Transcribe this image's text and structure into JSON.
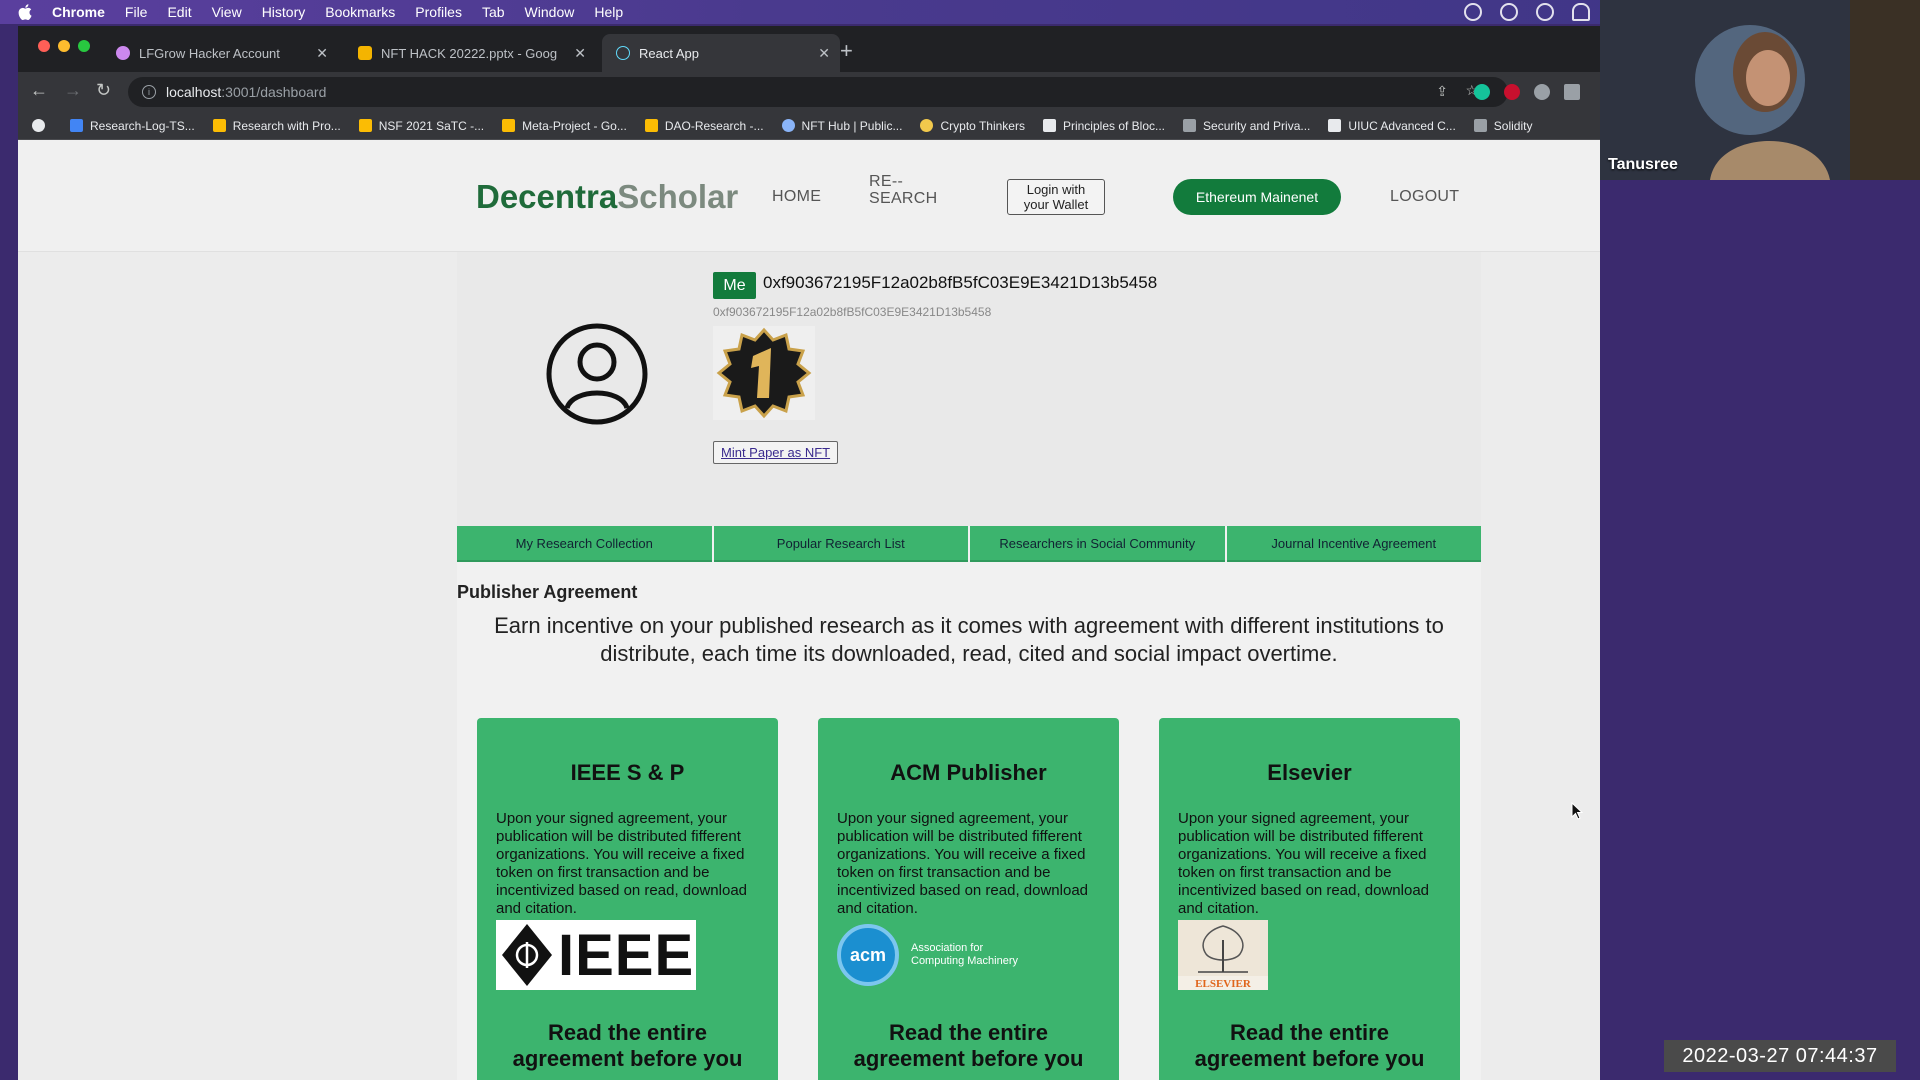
{
  "menubar": {
    "app": "Chrome",
    "items": [
      "File",
      "Edit",
      "View",
      "History",
      "Bookmarks",
      "Profiles",
      "Tab",
      "Window",
      "Help"
    ]
  },
  "tabs": [
    {
      "title": "LFGrow Hacker Account",
      "active": false
    },
    {
      "title": "NFT HACK 20222.pptx - Googl",
      "active": false
    },
    {
      "title": "React App",
      "active": true
    }
  ],
  "address": {
    "host": "localhost",
    "path": ":3001/dashboard"
  },
  "bookmarks": [
    "Research-Log-TS...",
    "Research with Pro...",
    "NSF 2021 SaTC -...",
    "Meta-Project - Go...",
    "DAO-Research -...",
    "NFT Hub | Public...",
    "Crypto Thinkers",
    "Principles of Bloc...",
    "Security and Priva...",
    "UIUC Advanced C...",
    "Solidity"
  ],
  "header": {
    "logo_a": "Decentra",
    "logo_b": "Scholar",
    "nav_home": "HOME",
    "nav_research_1": "RE--",
    "nav_research_2": "SEARCH",
    "wallet_1": "Login with",
    "wallet_2": "your Wallet",
    "network": "Ethereum Mainenet",
    "logout": "LOGOUT"
  },
  "profile": {
    "me_label": "Me",
    "address_checksum": "0xf903672195F12a02b8fB5fC03E9E3421D13b5458",
    "address_lower": "0xf903672195F12a02b8fB5fC03E9E3421D13b5458",
    "mint_label": "Mint Paper as NFT"
  },
  "profile_tabs": [
    "My Research Collection",
    "Popular Research List",
    "Researchers in Social Community",
    "Journal Incentive Agreement"
  ],
  "section": {
    "title": "Publisher Agreement",
    "lead": "Earn incentive on your published research as it comes with agreement with different institutions to distribute, each time its downloaded, read, cited and social impact overtime."
  },
  "publishers": [
    {
      "name": "IEEE S & P",
      "body": "Upon your signed agreement, your publication will be distributed fifferent organizations. You will receive a fixed token on first transaction and be incentivized based on read, download and citation.",
      "logo_text": "IEEE",
      "read": "Read the entire agreement before you"
    },
    {
      "name": "ACM Publisher",
      "body": "Upon your signed agreement, your publication will be distributed fifferent organizations. You will receive a fixed token on first transaction and be incentivized based on read, download and citation.",
      "logo_text": "acm",
      "logo_sub_1": "Association for",
      "logo_sub_2": "Computing Machinery",
      "read": "Read the entire agreement before you"
    },
    {
      "name": "Elsevier",
      "body": "Upon your signed agreement, your publication will be distributed fifferent organizations. You will receive a fixed token on first transaction and be incentivized based on read, download and citation.",
      "logo_text": "ELSEVIER",
      "read": "Read the entire agreement before you"
    }
  ],
  "webcam": {
    "name": "Tanusree"
  },
  "timestamp": "2022-03-27  07:44:37",
  "colors": {
    "brand_green": "#127b3c",
    "card_green": "#3cb46e"
  }
}
